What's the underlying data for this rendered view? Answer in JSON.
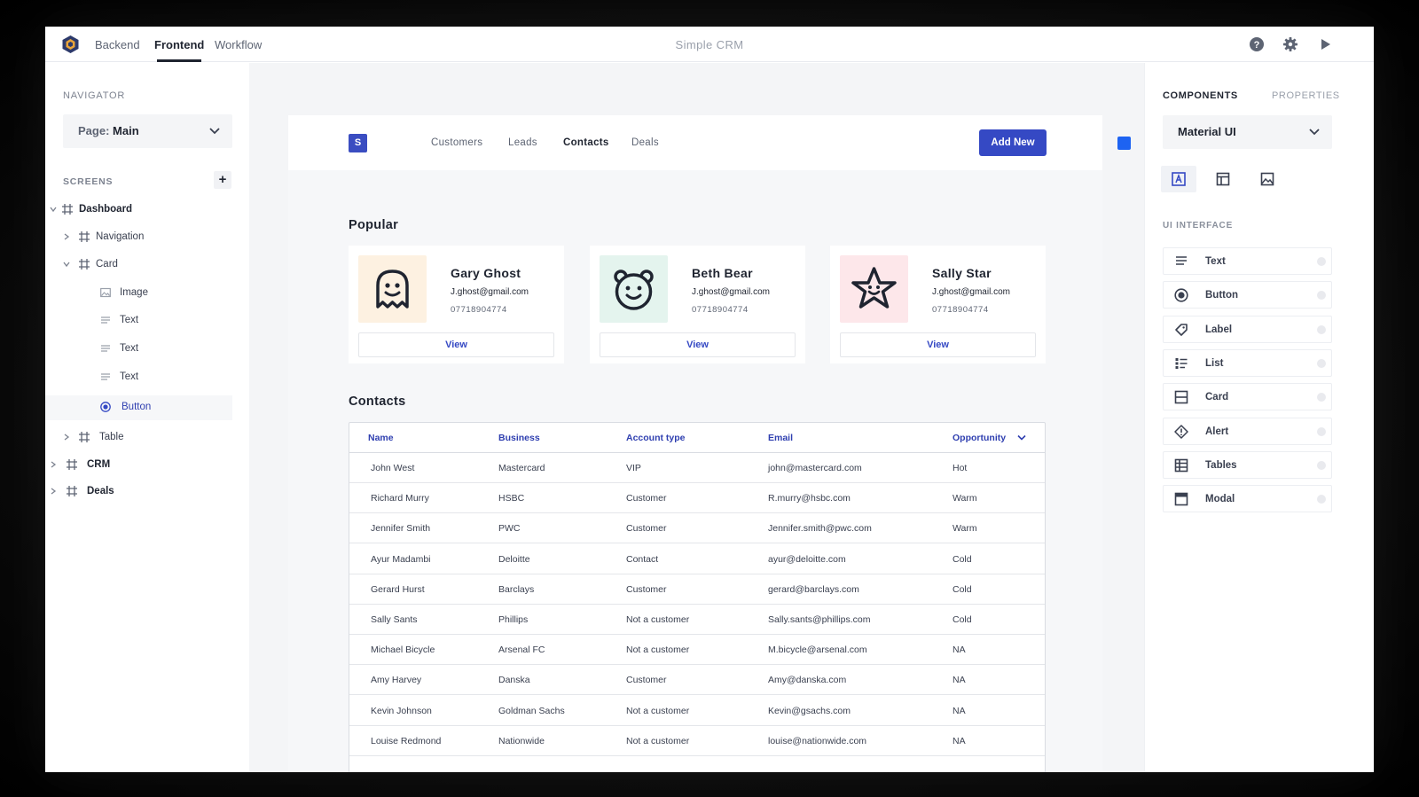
{
  "topbar": {
    "tabs": [
      "Backend",
      "Frontend",
      "Workflow"
    ],
    "active_tab": "Frontend",
    "app_title": "Simple CRM",
    "icons": [
      "help-icon",
      "settings-icon",
      "play-icon"
    ]
  },
  "navigator": {
    "title": "NAVIGATOR",
    "page_select": {
      "prefix": "Page:",
      "value": "Main"
    },
    "screens_title": "SCREENS",
    "add_label": "+",
    "tree": [
      {
        "label": "Dashboard",
        "icon": "frame-icon",
        "expanded": true
      },
      {
        "label": "Navigation",
        "icon": "frame-icon"
      },
      {
        "label": "Card",
        "icon": "frame-icon",
        "expanded": true
      },
      {
        "label": "Image",
        "icon": "image-icon"
      },
      {
        "label": "Text",
        "icon": "text-icon"
      },
      {
        "label": "Text",
        "icon": "text-icon"
      },
      {
        "label": "Text",
        "icon": "text-icon"
      },
      {
        "label": "Button",
        "icon": "radio-icon",
        "selected": true
      },
      {
        "label": "Table",
        "icon": "frame-icon"
      },
      {
        "label": "CRM",
        "icon": "frame-icon"
      },
      {
        "label": "Deals",
        "icon": "frame-icon"
      }
    ]
  },
  "preview": {
    "logo_letter": "S",
    "nav_links": [
      "Customers",
      "Leads",
      "Contacts",
      "Deals"
    ],
    "active_link": "Contacts",
    "add_button": "Add New",
    "popular_title": "Popular",
    "contacts_title": "Contacts",
    "cards": [
      {
        "name": "Gary Ghost",
        "email": "J.ghost@gmail.com",
        "phone": "07718904774",
        "button": "View",
        "bg": "#fdf1e1",
        "icon": "ghost-icon"
      },
      {
        "name": "Beth Bear",
        "email": "J.ghost@gmail.com",
        "phone": "07718904774",
        "button": "View",
        "bg": "#e4f4ee",
        "icon": "bear-icon"
      },
      {
        "name": "Sally Star",
        "email": "J.ghost@gmail.com",
        "phone": "07718904774",
        "button": "View",
        "bg": "#fde7ea",
        "icon": "star-icon"
      }
    ],
    "table": {
      "headers": [
        "Name",
        "Business",
        "Account type",
        "Email",
        "Opportunity"
      ],
      "rows": [
        [
          "John West",
          "Mastercard",
          "VIP",
          "john@mastercard.com",
          "Hot"
        ],
        [
          "Richard Murry",
          "HSBC",
          "Customer",
          "R.murry@hsbc.com",
          "Warm"
        ],
        [
          "Jennifer Smith",
          "PWC",
          "Customer",
          "Jennifer.smith@pwc.com",
          "Warm"
        ],
        [
          "Ayur Madambi",
          "Deloitte",
          "Contact",
          "ayur@deloitte.com",
          "Cold"
        ],
        [
          "Gerard Hurst",
          "Barclays",
          "Customer",
          "gerard@barclays.com",
          "Cold"
        ],
        [
          "Sally Sants",
          "Phillips",
          "Not a customer",
          "Sally.sants@phillips.com",
          "Cold"
        ],
        [
          "Michael Bicycle",
          "Arsenal FC",
          "Not a customer",
          "M.bicycle@arsenal.com",
          "NA"
        ],
        [
          "Amy Harvey",
          "Danska",
          "Customer",
          "Amy@danska.com",
          "NA"
        ],
        [
          "Kevin Johnson",
          "Goldman Sachs",
          "Not a customer",
          "Kevin@gsachs.com",
          "NA"
        ],
        [
          "Louise Redmond",
          "Nationwide",
          "Not a customer",
          "louise@nationwide.com",
          "NA"
        ]
      ]
    }
  },
  "right_panel": {
    "tabs": [
      "COMPONENTS",
      "PROPERTIES"
    ],
    "active_tab": "COMPONENTS",
    "library": "Material UI",
    "category_icons": [
      "text-format-icon",
      "layout-icon",
      "image-icon"
    ],
    "section_title": "UI INTERFACE",
    "components": [
      {
        "label": "Text",
        "icon": "text-lines-icon"
      },
      {
        "label": "Button",
        "icon": "radio-button-icon"
      },
      {
        "label": "Label",
        "icon": "tag-icon"
      },
      {
        "label": "List",
        "icon": "list-icon"
      },
      {
        "label": "Card",
        "icon": "card-icon"
      },
      {
        "label": "Alert",
        "icon": "alert-icon"
      },
      {
        "label": "Tables",
        "icon": "table-icon"
      },
      {
        "label": "Modal",
        "icon": "modal-icon"
      }
    ]
  },
  "colors": {
    "accent": "#3549c4",
    "header_text": "#2f3fb0",
    "selection_square": "#1d63f2"
  }
}
